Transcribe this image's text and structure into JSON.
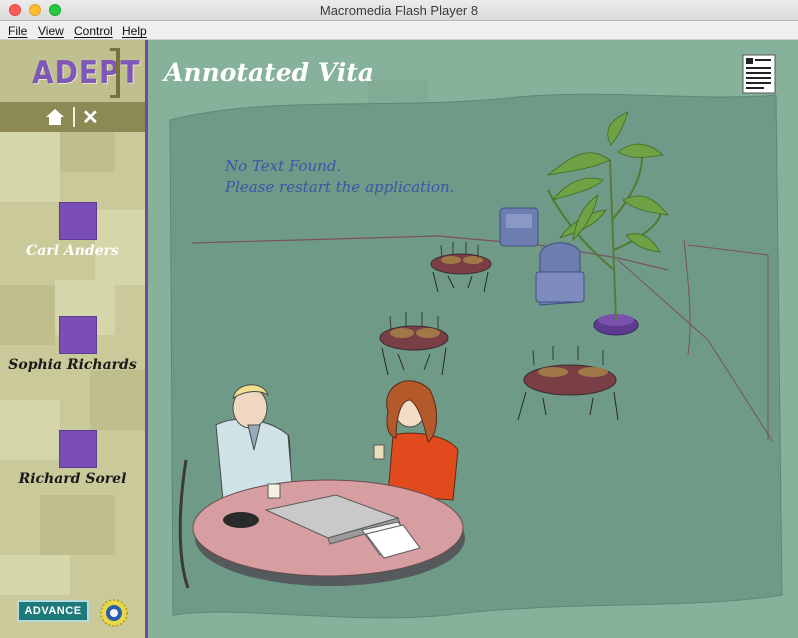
{
  "window": {
    "title": "Macromedia Flash Player 8"
  },
  "menu": {
    "file": "File",
    "view": "View",
    "control": "Control",
    "help": "Help"
  },
  "sidebar": {
    "logo": "ADEPT",
    "people": [
      {
        "name": "Carl Anders",
        "state": "active"
      },
      {
        "name": "Sophia Richards",
        "state": "inactive"
      },
      {
        "name": "Richard Sorel",
        "state": "inactive"
      }
    ],
    "partner_logo": "ADVANCE"
  },
  "main": {
    "title": "Annotated Vita",
    "notice_line1": "No Text Found.",
    "notice_line2": "Please restart the application."
  },
  "colors": {
    "sidebar_bg": "#c9c99a",
    "accent_purple": "#7b4eb7",
    "stage_green": "#87b29c",
    "notice_blue": "#3b56a8"
  },
  "icons": [
    "home-icon",
    "close-icon",
    "document-icon",
    "seal-icon"
  ]
}
